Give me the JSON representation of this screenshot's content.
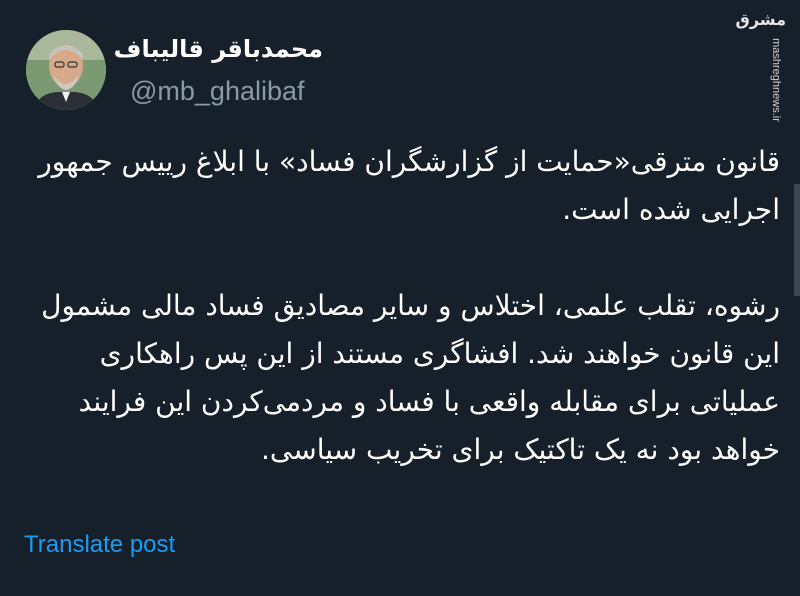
{
  "author": {
    "display_name": "محمدباقر قالیباف",
    "handle": "@mb_ghalibaf"
  },
  "tweet": {
    "paragraphs": [
      "قانون مترقی«حمایت از گزارشگران فساد» با ابلاغ رییس جمهور اجرایی شده است.",
      "رشوه، تقلب علمی، اختلاس و سایر مصادیق فساد مالی مشمول این قانون خواهند شد. افشاگری مستند از این پس راهکاری عملیاتی برای مقابله واقعی با فساد و مردمی‌کردن این فرایند خواهد بود نه یک تاکتیک برای تخریب سیاسی."
    ]
  },
  "actions": {
    "translate_label": "Translate post"
  },
  "watermark": {
    "logo": "مشرق",
    "site": "mashreghnews.ir"
  },
  "colors": {
    "background": "#15202b",
    "text": "#ffffff",
    "muted": "#8b98a5",
    "link": "#1d9bf0"
  }
}
